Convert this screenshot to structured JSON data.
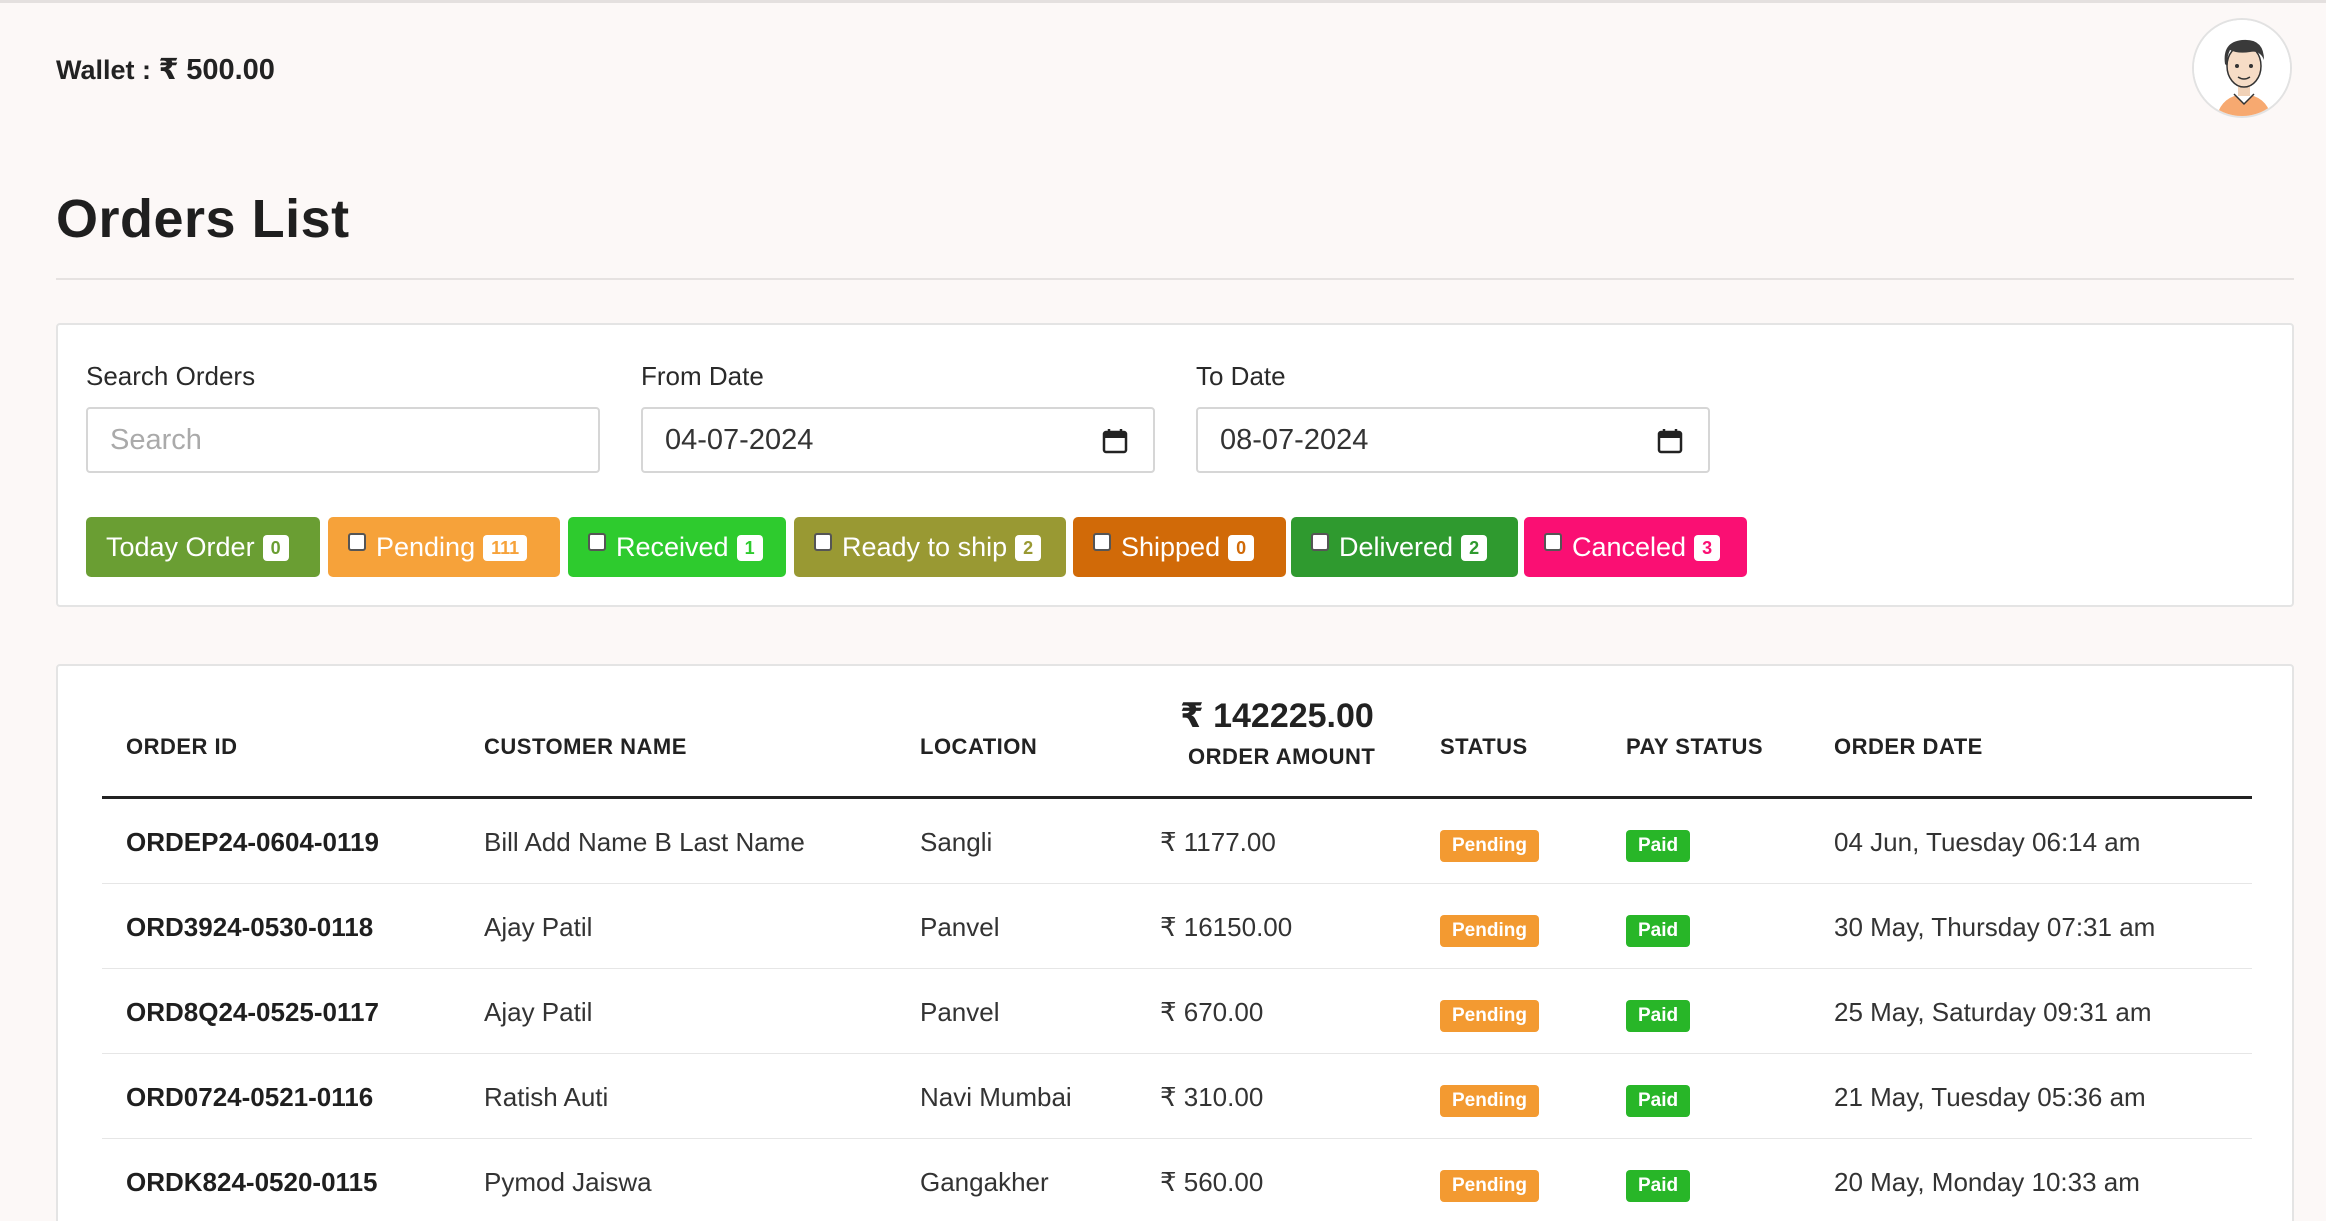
{
  "wallet": {
    "label": "Wallet :",
    "currency": "₹",
    "amount": "500.00"
  },
  "page": {
    "title": "Orders List"
  },
  "filters": {
    "search": {
      "label": "Search Orders",
      "placeholder": "Search"
    },
    "from_date": {
      "label": "From Date",
      "value": "04-07-2024"
    },
    "to_date": {
      "label": "To Date",
      "value": "08-07-2024"
    },
    "chips": [
      {
        "label": "Today Order",
        "count": "0",
        "color": "#6a9e33",
        "has_checkbox": false
      },
      {
        "label": "Pending",
        "count": "111",
        "color": "#f6a23a",
        "has_checkbox": true
      },
      {
        "label": "Received",
        "count": "1",
        "color": "#2ecb2e",
        "has_checkbox": true
      },
      {
        "label": "Ready to ship",
        "count": "2",
        "color": "#999933",
        "has_checkbox": true
      },
      {
        "label": "Shipped",
        "count": "0",
        "color": "#d16a08",
        "has_checkbox": true
      },
      {
        "label": "Delivered",
        "count": "2",
        "color": "#2f9a2f",
        "has_checkbox": true
      },
      {
        "label": "Canceled",
        "count": "3",
        "color": "#fa0f73",
        "has_checkbox": true
      }
    ]
  },
  "table": {
    "total_amount": "₹ 142225.00",
    "headers": {
      "order_id": "ORDER ID",
      "customer_name": "CUSTOMER NAME",
      "location": "LOCATION",
      "order_amount": "ORDER AMOUNT",
      "status": "STATUS",
      "pay_status": "PAY STATUS",
      "order_date": "ORDER DATE"
    },
    "rows": [
      {
        "order_id": "ORDEP24-0604-0119",
        "customer": "Bill Add Name B Last Name",
        "location": "Sangli",
        "amount": "₹ 1177.00",
        "status": "Pending",
        "pay_status": "Paid",
        "date": "04 Jun, Tuesday 06:14 am"
      },
      {
        "order_id": "ORD3924-0530-0118",
        "customer": "Ajay Patil",
        "location": "Panvel",
        "amount": "₹ 16150.00",
        "status": "Pending",
        "pay_status": "Paid",
        "date": "30 May, Thursday 07:31 am"
      },
      {
        "order_id": "ORD8Q24-0525-0117",
        "customer": "Ajay Patil",
        "location": "Panvel",
        "amount": "₹ 670.00",
        "status": "Pending",
        "pay_status": "Paid",
        "date": "25 May, Saturday 09:31 am"
      },
      {
        "order_id": "ORD0724-0521-0116",
        "customer": "Ratish Auti",
        "location": "Navi Mumbai",
        "amount": "₹ 310.00",
        "status": "Pending",
        "pay_status": "Paid",
        "date": "21 May, Tuesday 05:36 am"
      },
      {
        "order_id": "ORDK824-0520-0115",
        "customer": "Pymod Jaiswa",
        "location": "Gangakher",
        "amount": "₹ 560.00",
        "status": "Pending",
        "pay_status": "Paid",
        "date": "20 May, Monday 10:33 am"
      }
    ],
    "status_colors": {
      "Pending": "#f39a31",
      "Paid": "#28b628"
    }
  }
}
